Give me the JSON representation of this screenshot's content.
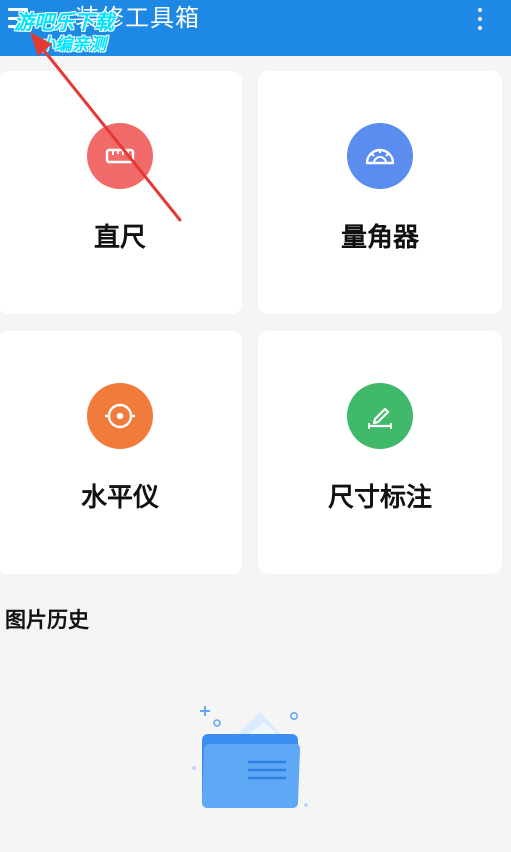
{
  "app": {
    "title": "装修工具箱"
  },
  "header": {
    "menu_icon": "hamburger-menu-icon",
    "more_icon": "vertical-dots-icon"
  },
  "watermark": {
    "line1": "游吧乐下载",
    "line2": "小编亲测"
  },
  "tools": [
    {
      "label": "直尺",
      "icon": "ruler-icon",
      "color": "#f16b6b"
    },
    {
      "label": "量角器",
      "icon": "protractor-icon",
      "color": "#5b8def"
    },
    {
      "label": "水平仪",
      "icon": "level-icon",
      "color": "#f07b3a"
    },
    {
      "label": "尺寸标注",
      "icon": "dimension-pencil-icon",
      "color": "#40b96a"
    }
  ],
  "history": {
    "title": "图片历史",
    "empty_icon": "empty-folder-icon"
  },
  "colors": {
    "topbar": "#1e88e5",
    "background": "#f5f5f5",
    "card": "#ffffff",
    "annotation_arrow": "#e53935"
  }
}
